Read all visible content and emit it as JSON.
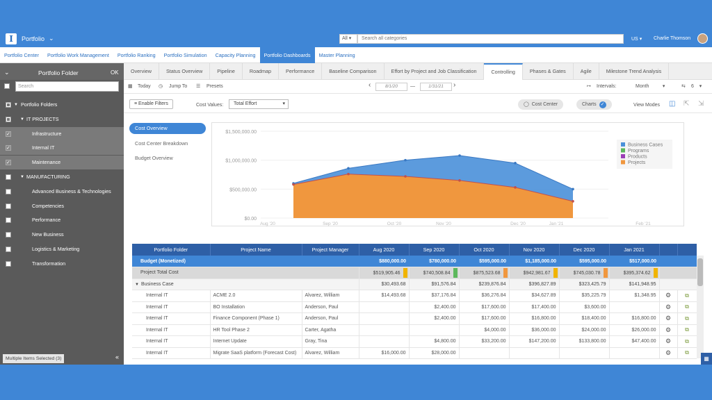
{
  "header": {
    "app_title": "Portfolio",
    "search_category": "All",
    "search_placeholder": "Search all categories",
    "locale": "US",
    "user_name": "Charlie Thomson"
  },
  "module_tabs": [
    {
      "label": "Portfolio Center",
      "active": false
    },
    {
      "label": "Portfolio Work Management",
      "active": false
    },
    {
      "label": "Portfolio Ranking",
      "active": false
    },
    {
      "label": "Portfolio Simulation",
      "active": false
    },
    {
      "label": "Capacity Planning",
      "active": false
    },
    {
      "label": "Portfolio Dashboards",
      "active": true
    },
    {
      "label": "Master Planning",
      "active": false
    }
  ],
  "sidebar": {
    "title": "Portfolio Folder",
    "ok_label": "OK",
    "search_placeholder": "Search",
    "footer_label": "Multiple Items Selected (3)",
    "items": [
      {
        "label": "Portfolio Folders",
        "level": 0,
        "checked": "partial",
        "selected": false
      },
      {
        "label": "IT PROJECTS",
        "level": 1,
        "checked": "partial",
        "selected": false
      },
      {
        "label": "Infrastructure",
        "level": 2,
        "checked": "on",
        "selected": true
      },
      {
        "label": "Internal IT",
        "level": 2,
        "checked": "on",
        "selected": true
      },
      {
        "label": "Maintenance",
        "level": 2,
        "checked": "on",
        "selected": true
      },
      {
        "label": "MANUFACTURING",
        "level": 1,
        "checked": "off",
        "selected": false
      },
      {
        "label": "Advanced Business & Technologies",
        "level": 2,
        "checked": "off",
        "selected": false
      },
      {
        "label": "Competencies",
        "level": 2,
        "checked": "off",
        "selected": false
      },
      {
        "label": "Performance",
        "level": 2,
        "checked": "off",
        "selected": false
      },
      {
        "label": "New Business",
        "level": 2,
        "checked": "off",
        "selected": false
      },
      {
        "label": "Logistics & Marketing",
        "level": 2,
        "checked": "off",
        "selected": false
      },
      {
        "label": "Transformation",
        "level": 2,
        "checked": "off",
        "selected": false
      }
    ]
  },
  "view_tabs": [
    {
      "label": "Overview",
      "active": false
    },
    {
      "label": "Status Overview",
      "active": false
    },
    {
      "label": "Pipeline",
      "active": false
    },
    {
      "label": "Roadmap",
      "active": false
    },
    {
      "label": "Performance",
      "active": false
    },
    {
      "label": "Baseline Comparison",
      "active": false
    },
    {
      "label": "Effort by Project and Job Classification",
      "active": false
    },
    {
      "label": "Controlling",
      "active": true
    },
    {
      "label": "Phases & Gates",
      "active": false
    },
    {
      "label": "Agile",
      "active": false
    },
    {
      "label": "Milestone Trend Analysis",
      "active": false
    }
  ],
  "toolbar": {
    "today": "Today",
    "jump_to": "Jump To",
    "presets": "Presets",
    "date_from": "8/1/20",
    "date_to": "1/31/21",
    "intervals_label": "Intervals:",
    "intervals_value": "Month",
    "interval_count": "6",
    "enable_filters": "Enable Filters",
    "cost_values_label": "Cost Values:",
    "cost_values_value": "Total Effort",
    "cost_center": "Cost Center",
    "charts": "Charts",
    "view_modes": "View Modes"
  },
  "content_nav": [
    {
      "label": "Cost Overview",
      "active": true
    },
    {
      "label": "Cost Center Breakdown",
      "active": false
    },
    {
      "label": "Budget Overview",
      "active": false
    }
  ],
  "chart_data": {
    "type": "area",
    "title": "",
    "xlabel": "",
    "ylabel": "",
    "x_ticks": [
      "Aug '20",
      "Sep '20",
      "Oct '20",
      "Nov '20",
      "Dec '20",
      "Jan '21",
      "Feb '21"
    ],
    "y_ticks": [
      "$0.00",
      "$500,000.00",
      "$1,000,000.00",
      "$1,500,000.00"
    ],
    "ylim": [
      0,
      1500000
    ],
    "legend_position": "right",
    "series": [
      {
        "name": "Business Cases",
        "color": "#4a90d9",
        "values": [
          600000,
          860000,
          1000000,
          1080000,
          950000,
          500000
        ]
      },
      {
        "name": "Programs",
        "color": "#5cb85c",
        "values": [
          0,
          0,
          0,
          0,
          0,
          0
        ]
      },
      {
        "name": "Products",
        "color": "#9b3fb5",
        "values": [
          0,
          0,
          0,
          0,
          0,
          0
        ]
      },
      {
        "name": "Projects",
        "color": "#f0973e",
        "values": [
          580000,
          760000,
          720000,
          650000,
          530000,
          290000
        ]
      }
    ],
    "x_points": [
      "Sep '20",
      "Oct '20",
      "Nov '20",
      "Dec '20",
      "Jan '21",
      "Jan '21b"
    ]
  },
  "table": {
    "columns": [
      "Portfolio Folder",
      "Project Name",
      "Project Manager",
      "Aug 2020",
      "Sep 2020",
      "Oct 2020",
      "Nov 2020",
      "Dec 2020",
      "Jan 2021"
    ],
    "budget_row": {
      "label": "Budget (Monetized)",
      "values": [
        "$880,000.00",
        "$780,000.00",
        "$595,000.00",
        "$1,185,000.00",
        "$595,000.00",
        "$517,000.00"
      ]
    },
    "total_row": {
      "label": "Project Total Cost",
      "values": [
        "$519,905.46",
        "$740,508.84",
        "$875,523.68",
        "$942,981.67",
        "$745,030.78",
        "$395,374.62"
      ],
      "flags": [
        "#f0b400",
        "#5cb85c",
        "#f0973e",
        "#f0b400",
        "#f0973e",
        "#f0b400"
      ]
    },
    "business_case_row": {
      "label": "Business Case",
      "values": [
        "$30,493.68",
        "$91,576.84",
        "$239,876.84",
        "$396,827.89",
        "$323,425.79",
        "$141,948.95"
      ]
    },
    "rows": [
      {
        "folder": "Internal IT",
        "project": "ACME 2.0",
        "manager": "Alvarez, William",
        "values": [
          "$14,493.68",
          "$37,176.84",
          "$36,276.84",
          "$34,627.89",
          "$35,225.79",
          "$1,348.95"
        ]
      },
      {
        "folder": "Internal IT",
        "project": "BO Installation",
        "manager": "Anderson, Paul",
        "values": [
          "",
          "$2,400.00",
          "$17,600.00",
          "$17,400.00",
          "$3,600.00",
          ""
        ]
      },
      {
        "folder": "Internal IT",
        "project": "Finance Component (Phase 1)",
        "manager": "Anderson, Paul",
        "values": [
          "",
          "$2,400.00",
          "$17,600.00",
          "$16,800.00",
          "$18,400.00",
          "$16,800.00"
        ]
      },
      {
        "folder": "Internal IT",
        "project": "HR Tool Phase 2",
        "manager": "Carter, Agatha",
        "values": [
          "",
          "",
          "$4,000.00",
          "$36,000.00",
          "$24,000.00",
          "$26,000.00"
        ]
      },
      {
        "folder": "Internal IT",
        "project": "Internet Update",
        "manager": "Gray, Tina",
        "values": [
          "",
          "$4,800.00",
          "$33,200.00",
          "$147,200.00",
          "$133,800.00",
          "$47,400.00"
        ]
      },
      {
        "folder": "Internal IT",
        "project": "Migrate SaaS platform (Forecast Cost)",
        "manager": "Alvarez, William",
        "values": [
          "$16,000.00",
          "$28,000.00",
          "",
          "",
          "",
          ""
        ]
      }
    ]
  }
}
